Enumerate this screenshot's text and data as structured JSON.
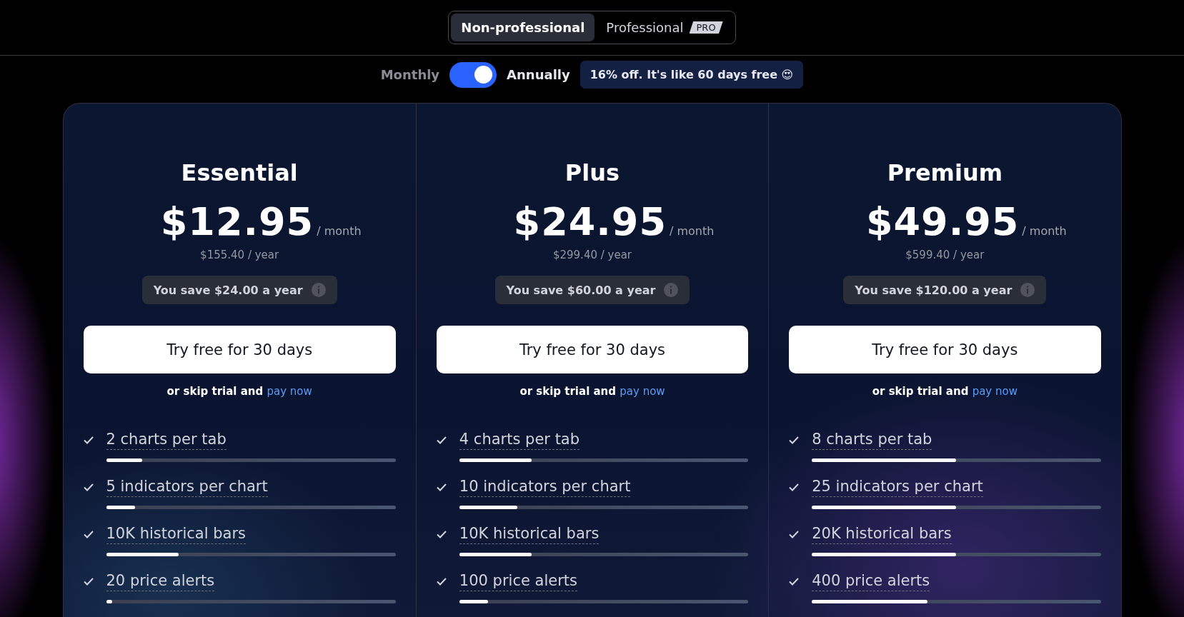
{
  "audience_tabs": [
    {
      "label": "Non-professional",
      "selected": true
    },
    {
      "label": "Professional",
      "selected": false,
      "badge": "PRO"
    }
  ],
  "billing": {
    "monthly_label": "Monthly",
    "annual_label": "Annually",
    "annual": true,
    "offer": "16% off. It's like 60 days free 😍"
  },
  "plans": [
    {
      "name": "Essential",
      "price": "$12.95",
      "period": "/ month",
      "yearly": "$155.40 / year",
      "savings": "You save $24.00 a year",
      "cta": "Try free for 30 days",
      "skip_text": "or skip trial and",
      "skip_link": "pay now",
      "features": [
        {
          "label": "2 charts per tab",
          "level": 0.125
        },
        {
          "label": "5 indicators per chart",
          "level": 0.1
        },
        {
          "label": "10K historical bars",
          "level": 0.25
        },
        {
          "label": "20 price alerts",
          "level": 0.02
        }
      ]
    },
    {
      "name": "Plus",
      "price": "$24.95",
      "period": "/ month",
      "yearly": "$299.40 / year",
      "savings": "You save $60.00 a year",
      "cta": "Try free for 30 days",
      "skip_text": "or skip trial and",
      "skip_link": "pay now",
      "features": [
        {
          "label": "4 charts per tab",
          "level": 0.25
        },
        {
          "label": "10 indicators per chart",
          "level": 0.2
        },
        {
          "label": "10K historical bars",
          "level": 0.25
        },
        {
          "label": "100 price alerts",
          "level": 0.1
        }
      ]
    },
    {
      "name": "Premium",
      "price": "$49.95",
      "period": "/ month",
      "yearly": "$599.40 / year",
      "savings": "You save $120.00 a year",
      "cta": "Try free for 30 days",
      "skip_text": "or skip trial and",
      "skip_link": "pay now",
      "features": [
        {
          "label": "8 charts per tab",
          "level": 0.5
        },
        {
          "label": "25 indicators per chart",
          "level": 0.5
        },
        {
          "label": "20K historical bars",
          "level": 0.5
        },
        {
          "label": "400 price alerts",
          "level": 0.4
        }
      ]
    }
  ]
}
